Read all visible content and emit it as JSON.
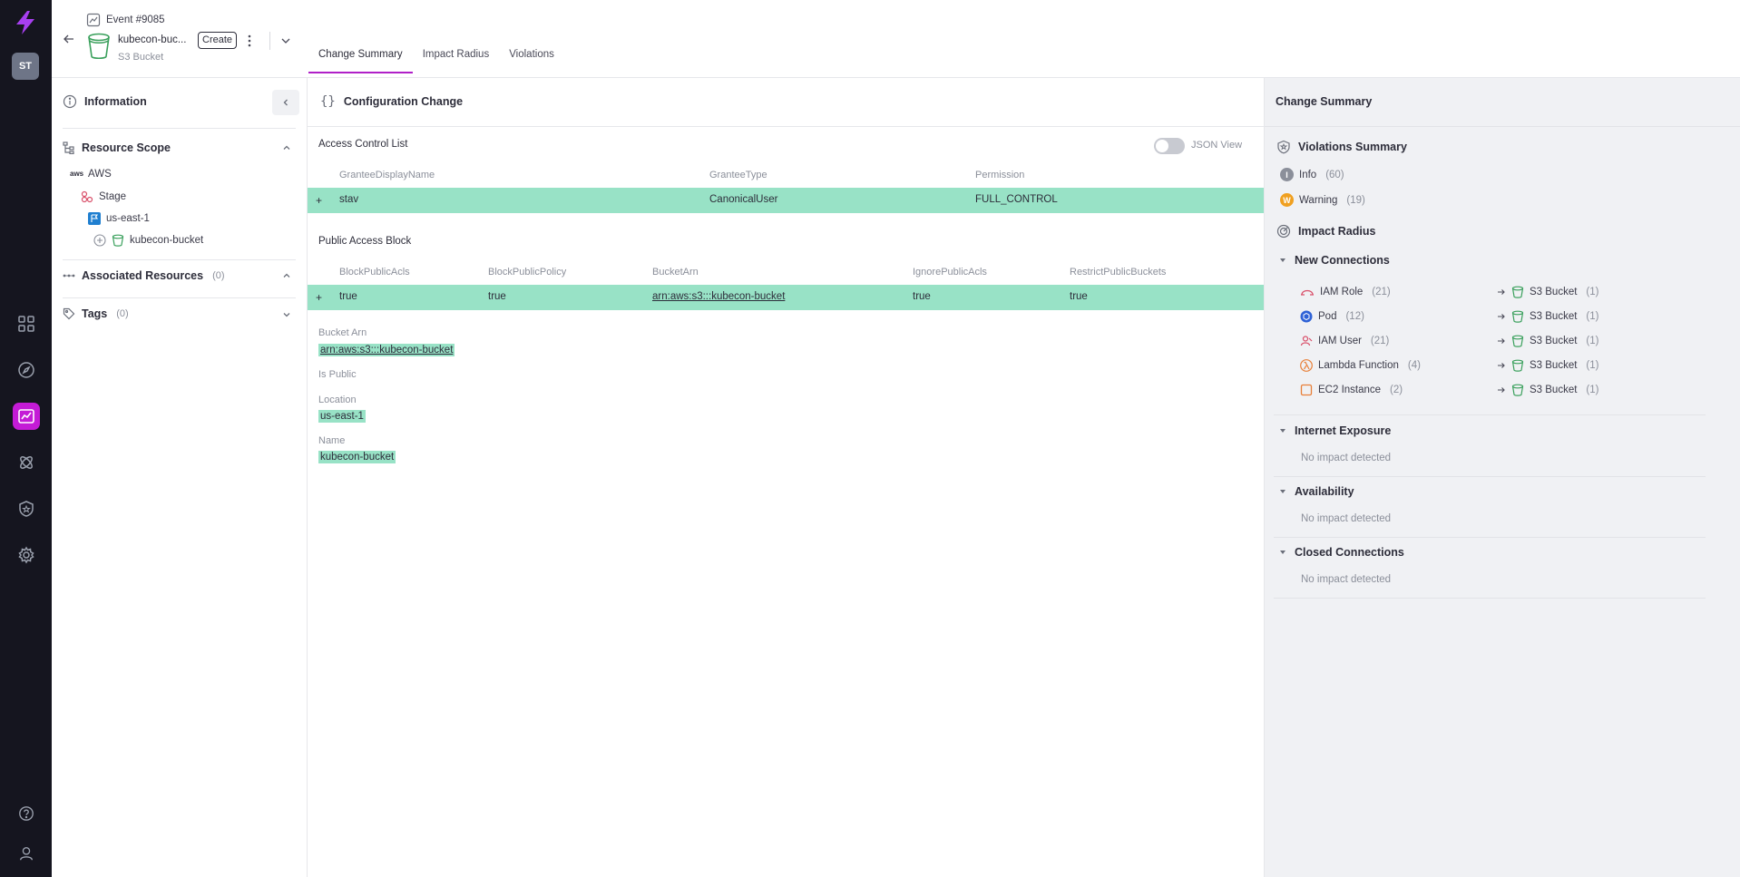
{
  "rail": {
    "avatar": "ST",
    "items": [
      "dashboard-icon",
      "compass-icon",
      "events-icon",
      "integrations-icon",
      "shield-icon",
      "settings-icon",
      "help-icon",
      "user-icon"
    ]
  },
  "header": {
    "event_label": "Event #9085",
    "resource_name": "kubecon-buc...",
    "change_badge": "Create",
    "resource_type": "S3 Bucket",
    "tabs": [
      {
        "label": "Change Summary"
      },
      {
        "label": "Impact Radius"
      },
      {
        "label": "Violations"
      }
    ]
  },
  "info_panel": {
    "title": "Information",
    "resource_scope": {
      "title": "Resource Scope",
      "tree": [
        "AWS",
        "Stage",
        "us-east-1",
        "kubecon-bucket"
      ],
      "aws_logo": "aws"
    },
    "associated": {
      "title": "Associated Resources",
      "count": "(0)"
    },
    "tags": {
      "title": "Tags",
      "count": "(0)"
    }
  },
  "config": {
    "title": "Configuration Change",
    "json_view_label": "JSON View",
    "acl": {
      "title": "Access Control List",
      "columns": [
        "GranteeDisplayName",
        "GranteeType",
        "Permission"
      ],
      "row": {
        "marker": "+",
        "cells": [
          "stav",
          "CanonicalUser",
          "FULL_CONTROL"
        ]
      }
    },
    "pab": {
      "title": "Public Access Block",
      "columns": [
        "BlockPublicAcls",
        "BlockPublicPolicy",
        "BucketArn",
        "IgnorePublicAcls",
        "RestrictPublicBuckets"
      ],
      "row": {
        "marker": "+",
        "cells": [
          "true",
          "true",
          "arn:aws:s3:::kubecon-bucket",
          "true",
          "true"
        ]
      }
    },
    "fields": [
      {
        "label": "Bucket Arn",
        "value": "arn:aws:s3:::kubecon-bucket"
      },
      {
        "label": "Is Public",
        "value": ""
      },
      {
        "label": "Location",
        "value": "us-east-1"
      },
      {
        "label": "Name",
        "value": "kubecon-bucket"
      }
    ]
  },
  "summary": {
    "title": "Change Summary",
    "violations": {
      "title": "Violations Summary",
      "items": [
        {
          "badge": "I",
          "label": "Info",
          "count": "(60)",
          "color": "#8b8f9a"
        },
        {
          "badge": "W",
          "label": "Warning",
          "count": "(19)",
          "color": "#f0a020"
        }
      ]
    },
    "impact": {
      "title": "Impact Radius",
      "new_connections": {
        "title": "New Connections",
        "rows": [
          {
            "source": "IAM Role",
            "source_count": "(21)",
            "target": "S3 Bucket",
            "target_count": "(1)"
          },
          {
            "source": "Pod",
            "source_count": "(12)",
            "target": "S3 Bucket",
            "target_count": "(1)"
          },
          {
            "source": "IAM User",
            "source_count": "(21)",
            "target": "S3 Bucket",
            "target_count": "(1)"
          },
          {
            "source": "Lambda Function",
            "source_count": "(4)",
            "target": "S3 Bucket",
            "target_count": "(1)"
          },
          {
            "source": "EC2 Instance",
            "source_count": "(2)",
            "target": "S3 Bucket",
            "target_count": "(1)"
          }
        ]
      },
      "sections": [
        {
          "title": "Internet Exposure",
          "text": "No impact detected"
        },
        {
          "title": "Availability",
          "text": "No impact detected"
        },
        {
          "title": "Closed Connections",
          "text": "No impact detected"
        }
      ]
    }
  },
  "colors": {
    "accent": "#b020c8",
    "rail": "#15151f",
    "added_row": "#98e2c6",
    "bucket_green": "#3aa05c"
  }
}
